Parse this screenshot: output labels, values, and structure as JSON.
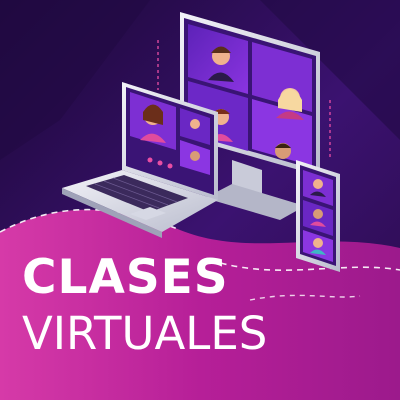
{
  "title": {
    "line1": "CLASES",
    "line2": "VIRTUALES"
  },
  "colors": {
    "background_dark": "#2a0b4a",
    "background_purple": "#4b1a86",
    "magenta_wave": "#c9239c",
    "pink_wave": "#e94ea4",
    "screen_glow": "#7a2bd6",
    "device_silver": "#d9dbe6",
    "text": "#ffffff"
  },
  "icons": [
    "monitor-icon",
    "laptop-icon",
    "smartphone-icon",
    "video-call-grid-icon"
  ]
}
